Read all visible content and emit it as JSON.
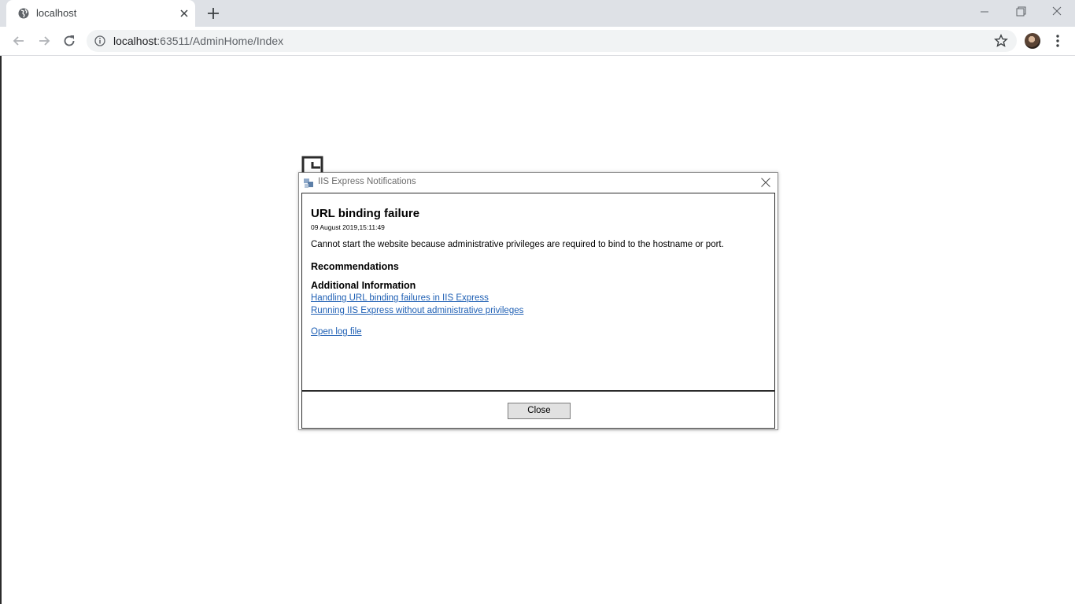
{
  "browser": {
    "tab_title": "localhost",
    "url_host": "localhost",
    "url_path": ":63511/AdminHome/Index"
  },
  "dialog": {
    "title": "IIS Express Notifications",
    "heading": "URL binding failure",
    "timestamp": "09 August 2019,15:11:49",
    "message": "Cannot start the website because administrative privileges are required to bind to the hostname or port.",
    "recommendations_heading": "Recommendations",
    "additional_heading": "Additional Information",
    "links": [
      "Handling URL binding failures in IIS Express",
      "Running IIS Express without administrative privileges"
    ],
    "log_link": "Open log file",
    "close_button": "Close"
  },
  "icons": {
    "favicon": "globe-icon",
    "tab_close": "close-icon",
    "new_tab": "plus-icon",
    "back": "arrow-left-icon",
    "forward": "arrow-right-icon",
    "reload": "reload-icon",
    "site_info": "info-icon",
    "bookmark": "star-icon",
    "menu": "kebab-icon",
    "minimize": "minimize-icon",
    "restore": "restore-icon",
    "window_close": "close-icon",
    "dialog_app": "iis-express-icon",
    "dialog_close": "close-icon"
  },
  "colors": {
    "tabstrip": "#dee1e6",
    "link": "#1e5fb4",
    "button": "#e1e1e1"
  }
}
